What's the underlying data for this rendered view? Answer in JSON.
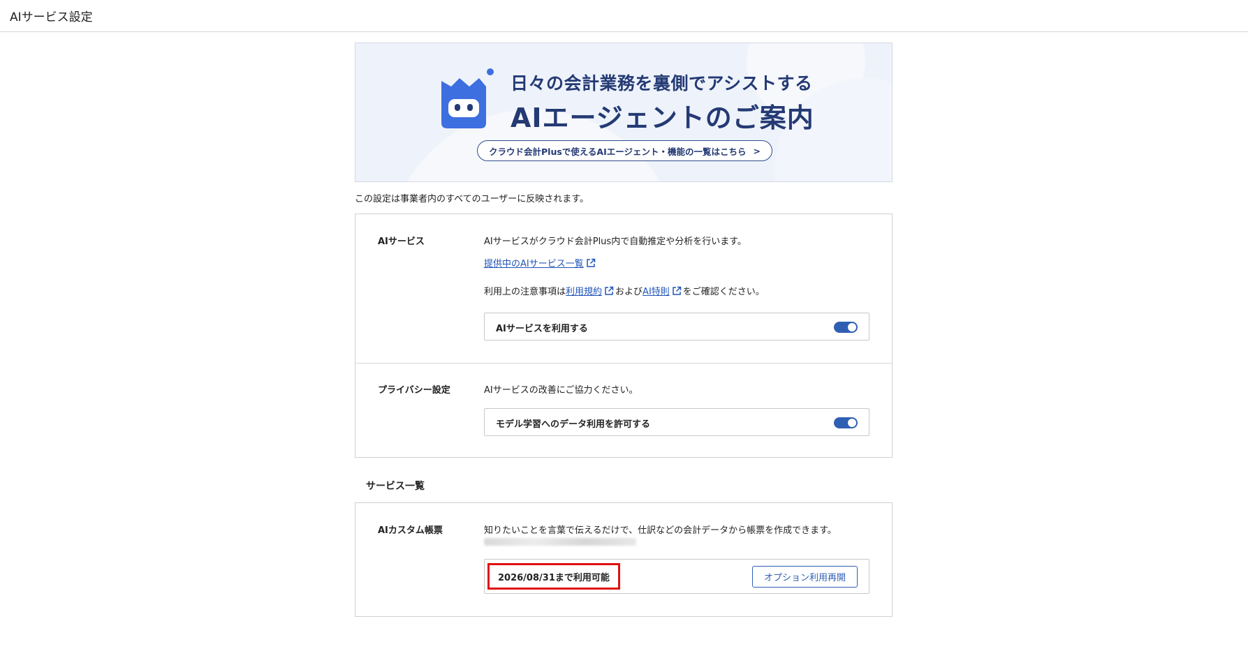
{
  "page": {
    "title": "AIサービス設定"
  },
  "banner": {
    "headline": "日々の会計業務を裏側でアシストする",
    "subheadline": "AIエージェントのご案内",
    "link_label": "クラウド会計Plusで使えるAIエージェント・機能の一覧はこちら",
    "link_chevron": ">",
    "colors": {
      "background": "#eef3fb",
      "text": "#243a74",
      "mascot": "#3d6fe0"
    }
  },
  "notice": "この設定は事業者内のすべてのユーザーに反映されます。",
  "ai_service": {
    "label": "AIサービス",
    "description": "AIサービスがクラウド会計Plus内で自動推定や分析を行います。",
    "services_link": "提供中のAIサービス一覧",
    "terms_prefix": "利用上の注意事項は",
    "terms_link": "利用規約",
    "terms_and": "および",
    "ai_terms_link": "AI特則",
    "terms_suffix": "をご確認ください。",
    "toggle_label": "AIサービスを利用する",
    "toggle_on": true
  },
  "privacy": {
    "label": "プライバシー設定",
    "description": "AIサービスの改善にご協力ください。",
    "toggle_label": "モデル学習へのデータ利用を許可する",
    "toggle_on": true
  },
  "service_list": {
    "title": "サービス一覧",
    "items": [
      {
        "label": "AIカスタム帳票",
        "description": "知りたいことを言葉で伝えるだけで、仕訳などの会計データから帳票を作成できます。",
        "availability": "2026/08/31まで利用可能",
        "button_label": "オプション利用再開"
      }
    ]
  },
  "colors": {
    "accent": "#2f5fb3",
    "link": "#2155b8",
    "highlight": "#e01010"
  }
}
